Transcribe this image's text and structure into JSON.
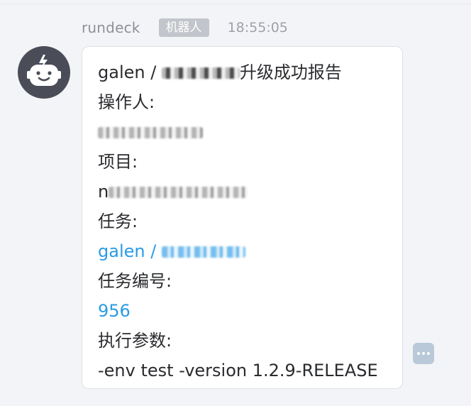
{
  "message": {
    "sender": "rundeck",
    "badge": "机器人",
    "time": "18:55:05",
    "title_prefix": "galen / ",
    "title_suffix": "升级成功报告",
    "operator_label": "操作人:",
    "project_label": "项目:",
    "project_value_visible": "n",
    "task_label": "任务:",
    "task_link_prefix": "galen / ",
    "task_number_label": "任务编号:",
    "task_number": "956",
    "params_label": "执行参数:",
    "params_value": "-env test -version 1.2.9-RELEASE"
  },
  "icons": {
    "avatar": "robot-icon",
    "more": "more-dots-icon"
  },
  "colors": {
    "background": "#f3f4f7",
    "avatar": "#4a4d58",
    "badge": "#c2c5cb",
    "link": "#2b9be6",
    "more_button": "#b9c9d8"
  }
}
